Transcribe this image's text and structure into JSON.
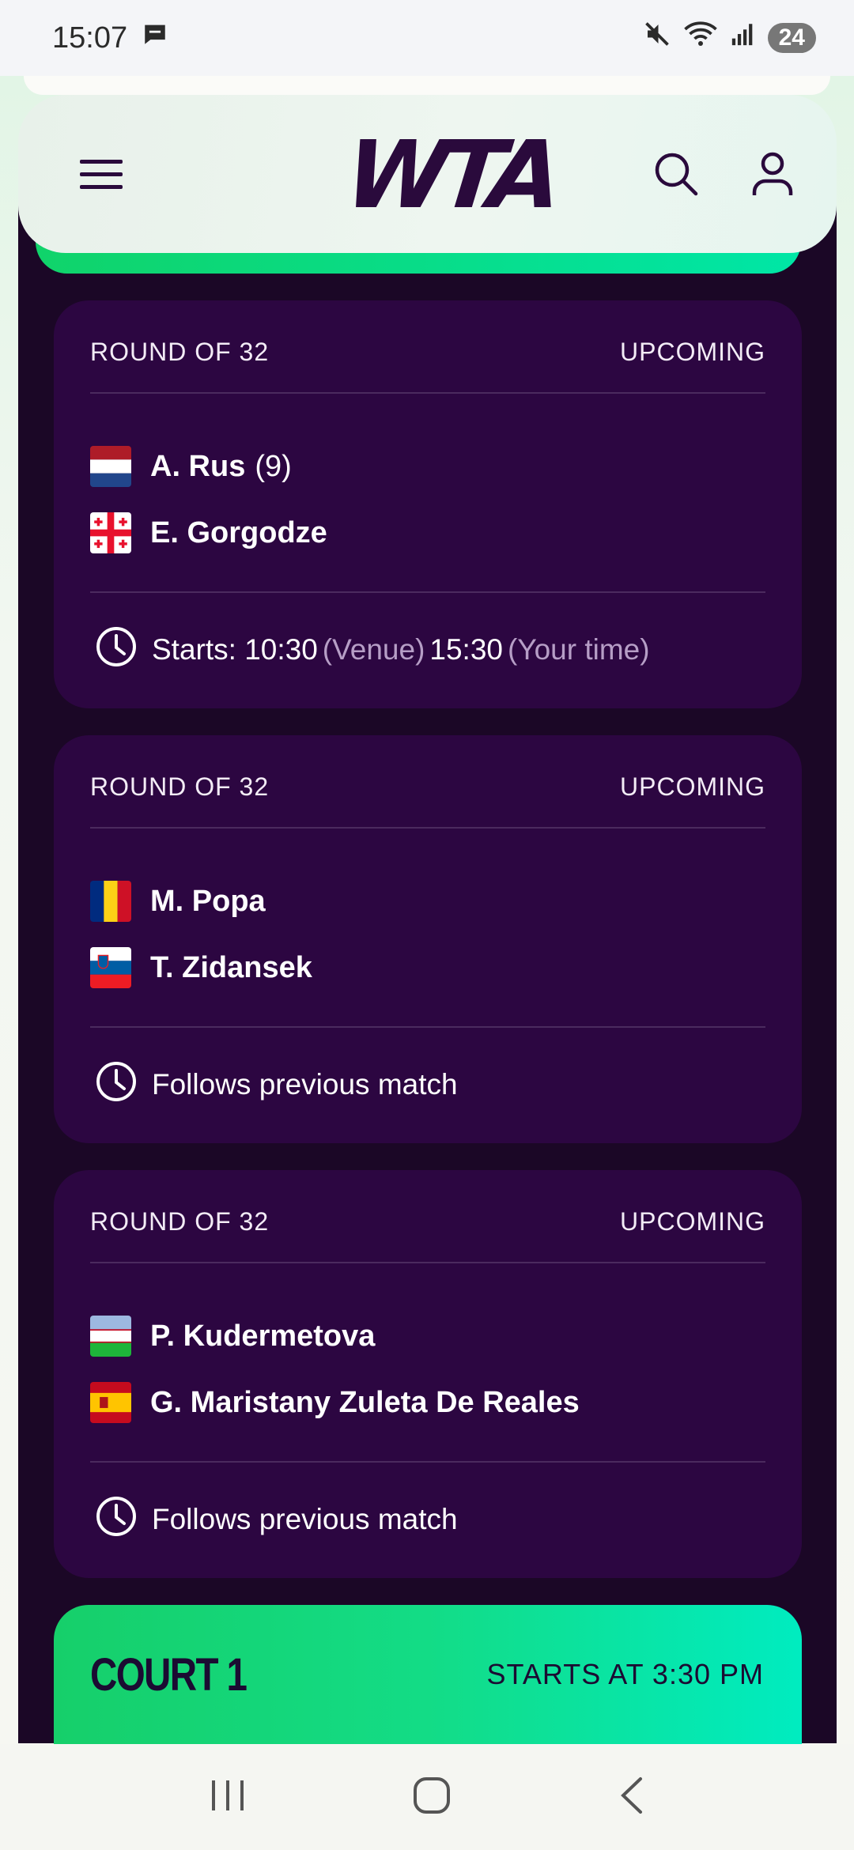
{
  "status_bar": {
    "time": "15:07",
    "battery": "24"
  },
  "header": {
    "logo": "WTA",
    "icons": [
      "menu-icon",
      "search-icon",
      "user-icon"
    ]
  },
  "matches": [
    {
      "round": "ROUND OF 32",
      "status": "UPCOMING",
      "players": [
        {
          "name": "A. Rus",
          "seed": "(9)",
          "flag": "netherlands"
        },
        {
          "name": "E. Gorgodze",
          "seed": "",
          "flag": "georgia"
        }
      ],
      "time": {
        "prefix": "Starts: 10:30",
        "venue_label": "(Venue)",
        "local_time": "15:30",
        "local_label": "(Your time)"
      }
    },
    {
      "round": "ROUND OF 32",
      "status": "UPCOMING",
      "players": [
        {
          "name": "M. Popa",
          "seed": "",
          "flag": "romania"
        },
        {
          "name": "T. Zidansek",
          "seed": "",
          "flag": "slovenia"
        }
      ],
      "time_text": "Follows previous match"
    },
    {
      "round": "ROUND OF 32",
      "status": "UPCOMING",
      "players": [
        {
          "name": "P. Kudermetova",
          "seed": "",
          "flag": "uzbekistan"
        },
        {
          "name": "G. Maristany Zuleta De Reales",
          "seed": "",
          "flag": "spain"
        }
      ],
      "time_text": "Follows previous match"
    }
  ],
  "court": {
    "title": "COURT 1",
    "starts": "STARTS AT 3:30 PM"
  },
  "colors": {
    "background_dark": "#1b0726",
    "card": "#2c0641",
    "accent_green": "#13dc86"
  }
}
